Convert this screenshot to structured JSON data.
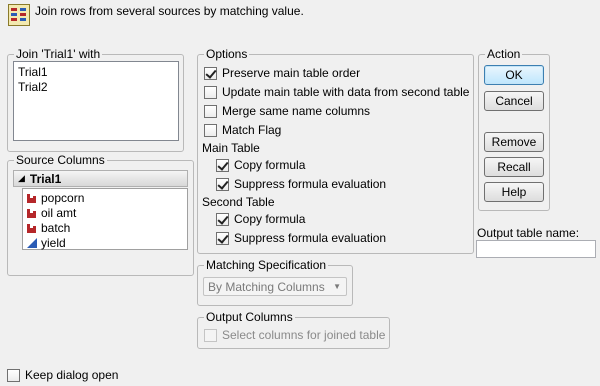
{
  "header": {
    "description": "Join rows from several sources by matching value."
  },
  "join_with": {
    "legend": "Join 'Trial1' with",
    "items": [
      "Trial1",
      "Trial2"
    ]
  },
  "source_columns": {
    "legend": "Source Columns",
    "table_name": "Trial1",
    "columns": [
      {
        "name": "popcorn",
        "icon": "nominal-bar-icon"
      },
      {
        "name": "oil amt",
        "icon": "nominal-bar-icon"
      },
      {
        "name": "batch",
        "icon": "nominal-bar-icon"
      },
      {
        "name": "yield",
        "icon": "continuous-triangle-icon"
      }
    ]
  },
  "options": {
    "legend": "Options",
    "preserve_main_order": "Preserve main table order",
    "update_main_table": "Update main table with data from second table",
    "merge_same_name": "Merge same name columns",
    "match_flag": "Match Flag",
    "main_table_label": "Main Table",
    "main_copy_formula": "Copy formula",
    "main_suppress_eval": "Suppress formula evaluation",
    "second_table_label": "Second Table",
    "second_copy_formula": "Copy formula",
    "second_suppress_eval": "Suppress formula evaluation"
  },
  "matching": {
    "legend": "Matching Specification",
    "selected": "By Matching Columns"
  },
  "output_columns": {
    "legend": "Output Columns",
    "select_label": "Select columns for joined table"
  },
  "action": {
    "legend": "Action",
    "ok": "OK",
    "cancel": "Cancel",
    "remove": "Remove",
    "recall": "Recall",
    "help": "Help"
  },
  "output_table": {
    "label": "Output table name:",
    "value": ""
  },
  "footer": {
    "keep_open": "Keep dialog open"
  },
  "colors": {
    "accent": "#3c7fb1",
    "nominal_icon": "#b5272a",
    "continuous_icon": "#2a5bb5"
  }
}
